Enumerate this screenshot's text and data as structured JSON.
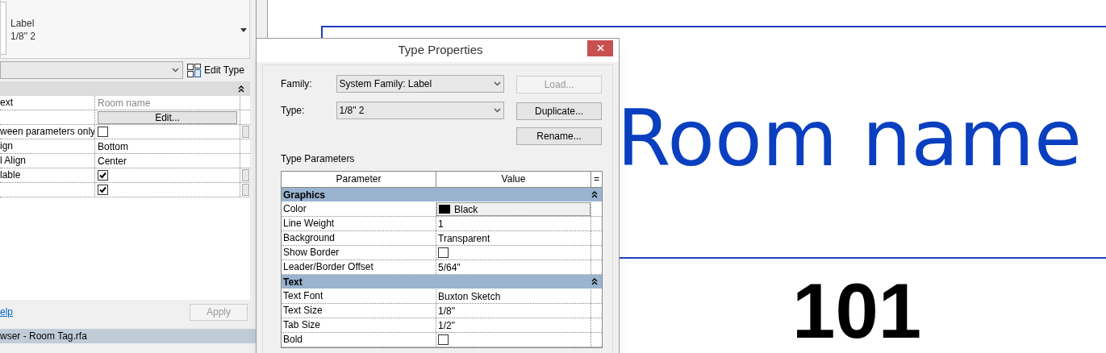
{
  "properties_panel": {
    "type_selector": {
      "family": "Label",
      "type": "1/8\" 2"
    },
    "edit_type_button": "Edit Type",
    "section_rows": [
      {
        "kind": "text",
        "name": "ext",
        "value": "Room name",
        "greyed": true
      },
      {
        "kind": "button",
        "name": "",
        "value": "Edit..."
      },
      {
        "kind": "checkbox",
        "name": "ween parameters only",
        "checked": false
      },
      {
        "kind": "text",
        "name": "ign",
        "value": "Bottom",
        "greyed": false
      },
      {
        "kind": "text",
        "name": "l Align",
        "value": "Center",
        "greyed": false
      },
      {
        "kind": "checkbox",
        "name": "lable",
        "checked": true
      },
      {
        "kind": "checkbox",
        "name": "",
        "checked": true
      }
    ],
    "help_link": "elp",
    "apply_button": {
      "label": "Apply",
      "disabled": true
    },
    "browser_title": "wser - Room Tag.rfa"
  },
  "dialog": {
    "title": "Type Properties",
    "family": {
      "label": "Family:",
      "value": "System Family: Label"
    },
    "type": {
      "label": "Type:",
      "value": "1/8\" 2"
    },
    "buttons": [
      {
        "label": "Load...",
        "disabled": true
      },
      {
        "label": "Duplicate...",
        "disabled": false
      },
      {
        "label": "Rename...",
        "disabled": false
      }
    ],
    "section_label": "Type Parameters",
    "columns": [
      "Parameter",
      "Value",
      "="
    ],
    "groups": [
      {
        "name": "Graphics",
        "rows": [
          {
            "kind": "color",
            "name": "Color",
            "value": "Black",
            "color": "#000000"
          },
          {
            "kind": "text",
            "name": "Line Weight",
            "value": "1"
          },
          {
            "kind": "text",
            "name": "Background",
            "value": "Transparent"
          },
          {
            "kind": "checkbox",
            "name": "Show Border",
            "checked": false
          },
          {
            "kind": "text",
            "name": "Leader/Border Offset",
            "value": "5/64\""
          }
        ]
      },
      {
        "name": "Text",
        "rows": [
          {
            "kind": "text",
            "name": "Text Font",
            "value": "Buxton Sketch"
          },
          {
            "kind": "text",
            "name": "Text Size",
            "value": "1/8\""
          },
          {
            "kind": "text",
            "name": "Tab Size",
            "value": "1/2\""
          },
          {
            "kind": "checkbox",
            "name": "Bold",
            "checked": false
          }
        ]
      }
    ]
  },
  "canvas": {
    "label_text": "Room name",
    "number_text": "101"
  }
}
